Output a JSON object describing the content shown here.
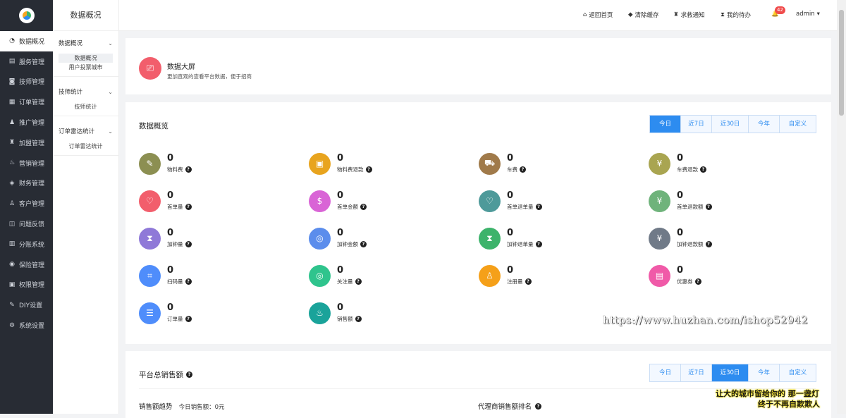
{
  "sidebar": {
    "items": [
      {
        "label": "数据概况",
        "icon": "◔"
      },
      {
        "label": "服务管理",
        "icon": "▤"
      },
      {
        "label": "技师管理",
        "icon": "◙"
      },
      {
        "label": "订单管理",
        "icon": "▦"
      },
      {
        "label": "推广管理",
        "icon": "♟"
      },
      {
        "label": "加盟管理",
        "icon": "♜"
      },
      {
        "label": "营销管理",
        "icon": "♨"
      },
      {
        "label": "财务管理",
        "icon": "◈"
      },
      {
        "label": "客户管理",
        "icon": "♙"
      },
      {
        "label": "问题反馈",
        "icon": "◫"
      },
      {
        "label": "分账系统",
        "icon": "▥"
      },
      {
        "label": "保险管理",
        "icon": "◉"
      },
      {
        "label": "权限管理",
        "icon": "▣"
      },
      {
        "label": "DIY设置",
        "icon": "✎"
      },
      {
        "label": "系统设置",
        "icon": "⚙"
      }
    ]
  },
  "subnav": {
    "title": "数据概况",
    "groups": [
      {
        "title": "数据概况",
        "items": [
          "数据概况",
          "用户投票城市"
        ]
      },
      {
        "title": "技师统计",
        "items": [
          "技师统计"
        ]
      },
      {
        "title": "订单雷达统计",
        "items": [
          "订单雷达统计"
        ]
      }
    ]
  },
  "header": {
    "home": "返回首页",
    "clear": "清除缓存",
    "help": "求救通知",
    "todo": "我的待办",
    "badge": "42",
    "user": "admin"
  },
  "card1": {
    "title": "数据大屏",
    "desc": "更加直观的查看平台数据，便于招商"
  },
  "overview": {
    "title": "数据概览",
    "tabs": [
      "今日",
      "近7日",
      "近30日",
      "今年",
      "自定义"
    ],
    "stats": [
      {
        "value": "0",
        "label": "物料费",
        "color": "#8c8f52",
        "icon": "✎"
      },
      {
        "value": "0",
        "label": "物料费退款",
        "color": "#e8a41e",
        "icon": "▣"
      },
      {
        "value": "0",
        "label": "车费",
        "color": "#a07a4a",
        "icon": "⛟"
      },
      {
        "value": "0",
        "label": "车费退款",
        "color": "#a9a551",
        "icon": "¥"
      },
      {
        "value": "0",
        "label": "首单量",
        "color": "#f25e6c",
        "icon": "♡"
      },
      {
        "value": "0",
        "label": "首单金额",
        "color": "#d964d6",
        "icon": "$"
      },
      {
        "value": "0",
        "label": "首单退单量",
        "color": "#4e9a9a",
        "icon": "♡"
      },
      {
        "value": "0",
        "label": "首单退款额",
        "color": "#6fb37b",
        "icon": "¥"
      },
      {
        "value": "0",
        "label": "加钟量",
        "color": "#8f79d8",
        "icon": "⧗"
      },
      {
        "value": "0",
        "label": "加钟金额",
        "color": "#5b8dec",
        "icon": "◎"
      },
      {
        "value": "0",
        "label": "加钟退单量",
        "color": "#3db36b",
        "icon": "⧗"
      },
      {
        "value": "0",
        "label": "加钟退款额",
        "color": "#707a88",
        "icon": "¥"
      },
      {
        "value": "0",
        "label": "扫码量",
        "color": "#4f8dfb",
        "icon": "⌗"
      },
      {
        "value": "0",
        "label": "关注量",
        "color": "#2fc48d",
        "icon": "◎"
      },
      {
        "value": "0",
        "label": "注册量",
        "color": "#f5a019",
        "icon": "♙"
      },
      {
        "value": "0",
        "label": "优惠券",
        "color": "#f05aa8",
        "icon": "▤"
      },
      {
        "value": "0",
        "label": "订单量",
        "color": "#4f8dfb",
        "icon": "☰"
      },
      {
        "value": "0",
        "label": "销售额",
        "color": "#1aa39a",
        "icon": "♨"
      }
    ]
  },
  "sales": {
    "title": "平台总销售额",
    "tabs": [
      "今日",
      "近7日",
      "近30日",
      "今年",
      "自定义"
    ],
    "trend": "销售额趋势",
    "today": "今日销售额：0元",
    "rank": "代理商销售额排名"
  },
  "watermark": "https://www.huzhan.com/ishop52942",
  "promo": [
    "让大的城市留给你的",
    "那一盏灯",
    "终于不再自欺欺人"
  ]
}
